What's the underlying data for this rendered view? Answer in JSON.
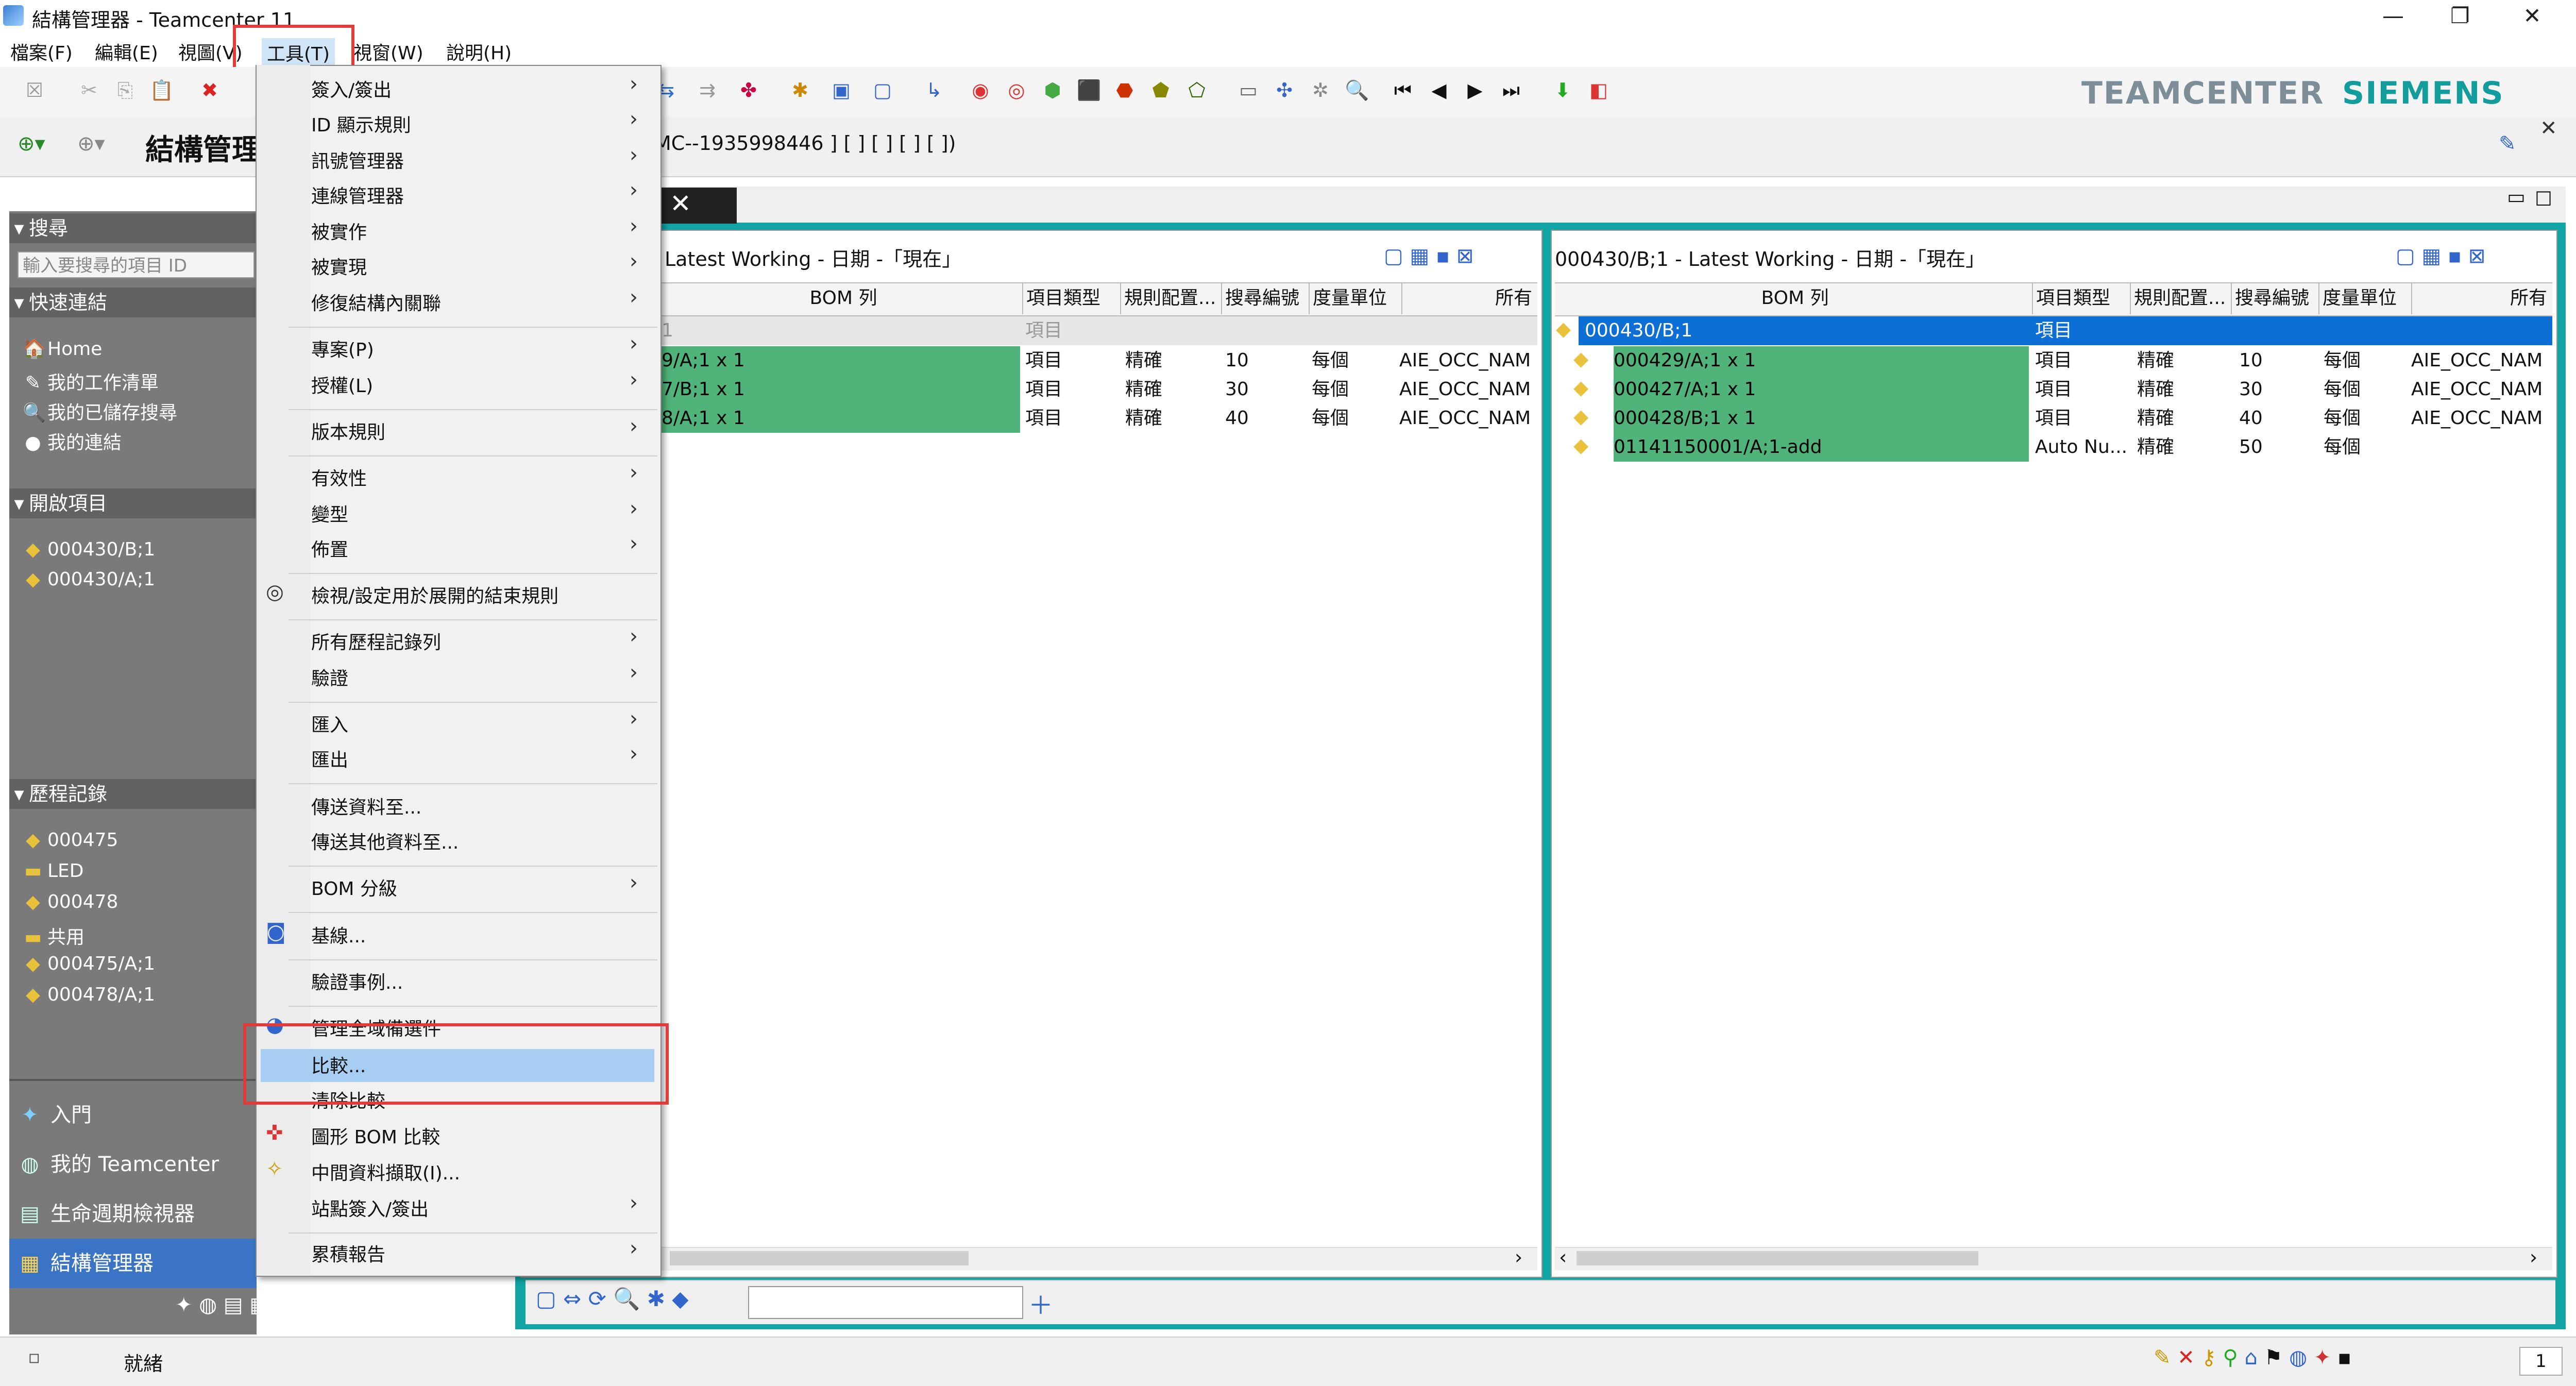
{
  "window": {
    "title": "結構管理器 - Teamcenter 11",
    "controls": [
      "minimize",
      "restore",
      "close"
    ]
  },
  "menubar": {
    "items": [
      "檔案(F)",
      "編輯(E)",
      "視圖(V)",
      "工具(T)",
      "視窗(W)",
      "說明(H)"
    ]
  },
  "brand": {
    "left": "TEAMCENTER",
    "right": "SIEMENS"
  },
  "perspective": {
    "title": "結構管理",
    "breadcrumb": "MC--1935998446 ] [ ] [ ] [ ] [ ])"
  },
  "navigator": {
    "search_header": "搜尋",
    "search_placeholder": "輸入要搜尋的項目 ID",
    "quick_links_header": "快速連結",
    "quick_links": [
      "Home",
      "我的工作清單",
      "我的已儲存搜尋",
      "我的連結"
    ],
    "open_items_header": "開啟項目",
    "open_items": [
      "000430/B;1",
      "000430/A;1"
    ],
    "history_header": "歷程記錄",
    "history": [
      "000475",
      "LED",
      "000478",
      "共用",
      "000475/A;1",
      "000478/A;1"
    ],
    "applications": [
      "入門",
      "我的 Teamcenter",
      "生命週期檢視器",
      "結構管理器"
    ]
  },
  "tools_menu": {
    "items": [
      {
        "label": "簽入/簽出",
        "submenu": true
      },
      {
        "label": "ID 顯示規則",
        "submenu": true
      },
      {
        "label": "訊號管理器",
        "submenu": true
      },
      {
        "label": "連線管理器",
        "submenu": true
      },
      {
        "label": "被實作",
        "submenu": true
      },
      {
        "label": "被實現",
        "submenu": true
      },
      {
        "label": "修復結構內關聯",
        "submenu": true
      },
      {
        "label": "專案(P)",
        "submenu": true
      },
      {
        "label": "授權(L)",
        "submenu": true
      },
      {
        "label": "版本規則",
        "submenu": true
      },
      {
        "label": "有效性",
        "submenu": true
      },
      {
        "label": "變型",
        "submenu": true
      },
      {
        "label": "佈置",
        "submenu": true
      },
      {
        "label": "檢視/設定用於展開的結束規則",
        "submenu": false
      },
      {
        "label": "所有歷程記錄列",
        "submenu": true
      },
      {
        "label": "驗證",
        "submenu": true
      },
      {
        "label": "匯入",
        "submenu": true
      },
      {
        "label": "匯出",
        "submenu": true
      },
      {
        "label": "傳送資料至...",
        "submenu": false
      },
      {
        "label": "傳送其他資料至...",
        "submenu": false
      },
      {
        "label": "BOM 分級",
        "submenu": true
      },
      {
        "label": "基線...",
        "submenu": false
      },
      {
        "label": "驗證事例...",
        "submenu": false
      },
      {
        "label": "管理全域備選件",
        "submenu": false
      },
      {
        "label": "比較...",
        "submenu": false
      },
      {
        "label": "清除比較",
        "submenu": false
      },
      {
        "label": "圖形 BOM 比較",
        "submenu": false
      },
      {
        "label": "中間資料擷取(I)...",
        "submenu": false
      },
      {
        "label": "站點簽入/簽出",
        "submenu": true
      },
      {
        "label": "累積報告",
        "submenu": true
      }
    ],
    "highlighted": "比較..."
  },
  "left_pane": {
    "title": "Latest Working - 日期 -「現在」",
    "columns": [
      "BOM 列",
      "項目類型",
      "規則配置...",
      "搜尋編號",
      "度量單位",
      "所有"
    ],
    "rows": [
      {
        "bom": "1",
        "type": "項目",
        "rule": "",
        "find": "",
        "uom": "",
        "occ": ""
      },
      {
        "bom": "9/A;1 x 1",
        "type": "項目",
        "rule": "精確",
        "find": "10",
        "uom": "每個",
        "occ": "AIE_OCC_NAM"
      },
      {
        "bom": "7/B;1 x 1",
        "type": "項目",
        "rule": "精確",
        "find": "30",
        "uom": "每個",
        "occ": "AIE_OCC_NAM"
      },
      {
        "bom": "8/A;1 x 1",
        "type": "項目",
        "rule": "精確",
        "find": "40",
        "uom": "每個",
        "occ": "AIE_OCC_NAM"
      }
    ]
  },
  "right_pane": {
    "title": "000430/B;1 - Latest Working - 日期 -「現在」",
    "columns": [
      "BOM 列",
      "項目類型",
      "規則配置...",
      "搜尋編號",
      "度量單位",
      "所有"
    ],
    "rows": [
      {
        "bom": "000430/B;1",
        "type": "項目",
        "rule": "",
        "find": "",
        "uom": "",
        "occ": ""
      },
      {
        "bom": "000429/A;1 x 1",
        "type": "項目",
        "rule": "精確",
        "find": "10",
        "uom": "每個",
        "occ": "AIE_OCC_NAM"
      },
      {
        "bom": "000427/A;1 x 1",
        "type": "項目",
        "rule": "精確",
        "find": "30",
        "uom": "每個",
        "occ": "AIE_OCC_NAM"
      },
      {
        "bom": "000428/B;1 x 1",
        "type": "項目",
        "rule": "精確",
        "find": "40",
        "uom": "每個",
        "occ": "AIE_OCC_NAM"
      },
      {
        "bom": "01141150001/A;1-add",
        "type": "Auto Nu...",
        "rule": "精確",
        "find": "50",
        "uom": "每個",
        "occ": ""
      }
    ]
  },
  "status": {
    "text": "就緒",
    "count": "1"
  },
  "colors": {
    "accent_green": "#4fb37a",
    "selection_blue": "#0d6fd6",
    "highlight_red": "#e23b3b",
    "frame_teal": "#13a5a5"
  }
}
